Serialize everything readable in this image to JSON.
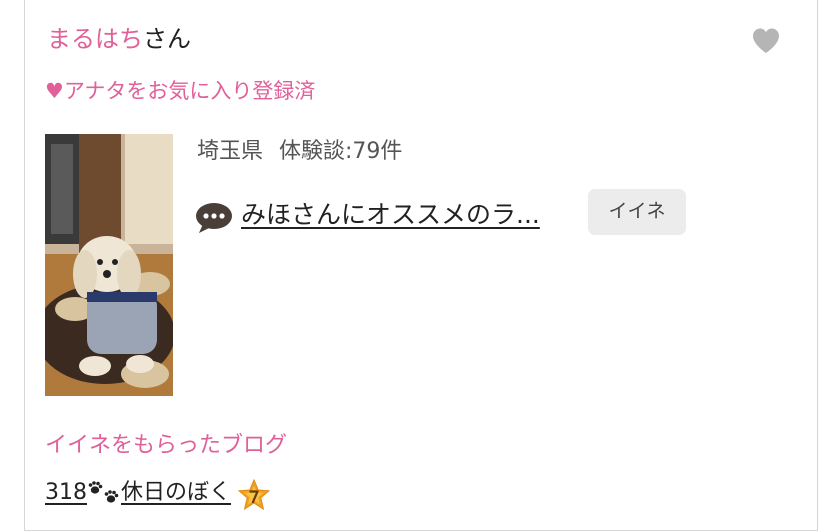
{
  "user": {
    "name": "まるはち",
    "honorific": "さん",
    "favorite_status": "♥アナタをお気に入り登録済"
  },
  "profile": {
    "prefecture": "埼玉県",
    "experience_count": "体験談:79件"
  },
  "latest_diary": {
    "title": "みほさんにオススメのラ..."
  },
  "actions": {
    "like_label": "イイネ"
  },
  "liked_blogs": {
    "heading": "イイネをもらったブログ",
    "item_prefix": "318",
    "item_suffix": "休日のぼく"
  },
  "icons": {
    "favorite": "heart-icon",
    "diary": "speech-bubble-icon",
    "paw": "paw-prints-icon",
    "star": "star-badge-icon"
  },
  "colors": {
    "accent_pink": "#e0609a",
    "heart_gray": "#b5b5b5",
    "button_bg": "#ececec",
    "star_orange": "#f2a020"
  }
}
